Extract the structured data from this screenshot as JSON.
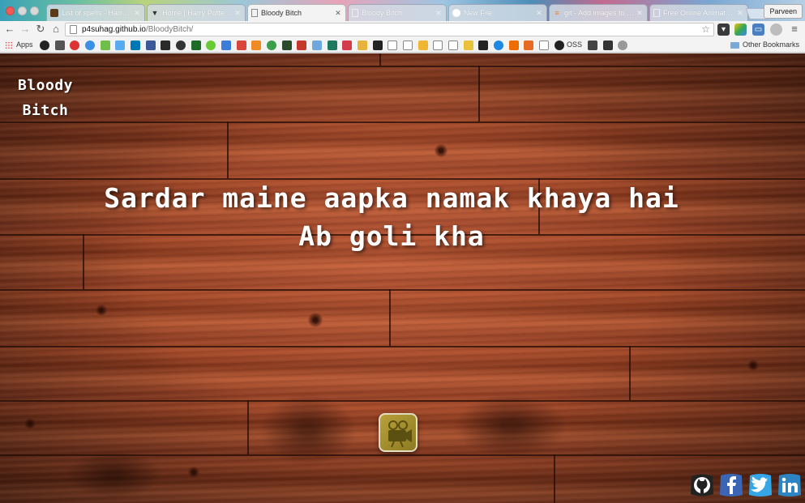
{
  "browser": {
    "tabs": [
      {
        "title": "List of spells - Harry Potter",
        "favicon": "hp-wiki-icon",
        "active": false
      },
      {
        "title": "Home | Harry Potter Art",
        "favicon": "pottermore-icon",
        "active": false
      },
      {
        "title": "Bloody Bitch",
        "favicon": "page-icon",
        "active": true
      },
      {
        "title": "Bloody Bitch",
        "favicon": "page-icon",
        "active": false
      },
      {
        "title": "New File",
        "favicon": "github-icon",
        "active": false
      },
      {
        "title": "git - Add images to readme",
        "favicon": "stackoverflow-icon",
        "active": false
      },
      {
        "title": "Free Online Animated Gif",
        "favicon": "page-icon",
        "active": false
      }
    ],
    "profile_name": "Parveen",
    "url_host": "p4suhag.github.io",
    "url_path": "/BloodyBitch/",
    "bookmarks": {
      "apps_label": "Apps",
      "oss_label": "OSS",
      "other_label": "Other Bookmarks"
    },
    "colors": {
      "close_light": "#ee5b54"
    }
  },
  "page": {
    "logo_line1": "Bloody",
    "logo_line2": "Bitch",
    "quote_line1": "Sardar maine aapka namak khaya hai",
    "quote_line2": "Ab goli kha",
    "play_button_icon": "movie-camera-icon",
    "social_links": [
      {
        "name": "github",
        "color": "#1e1e1e"
      },
      {
        "name": "facebook",
        "color": "#3b66b6"
      },
      {
        "name": "twitter",
        "color": "#35a6e6"
      },
      {
        "name": "linkedin",
        "color": "#2d84c2"
      }
    ]
  }
}
